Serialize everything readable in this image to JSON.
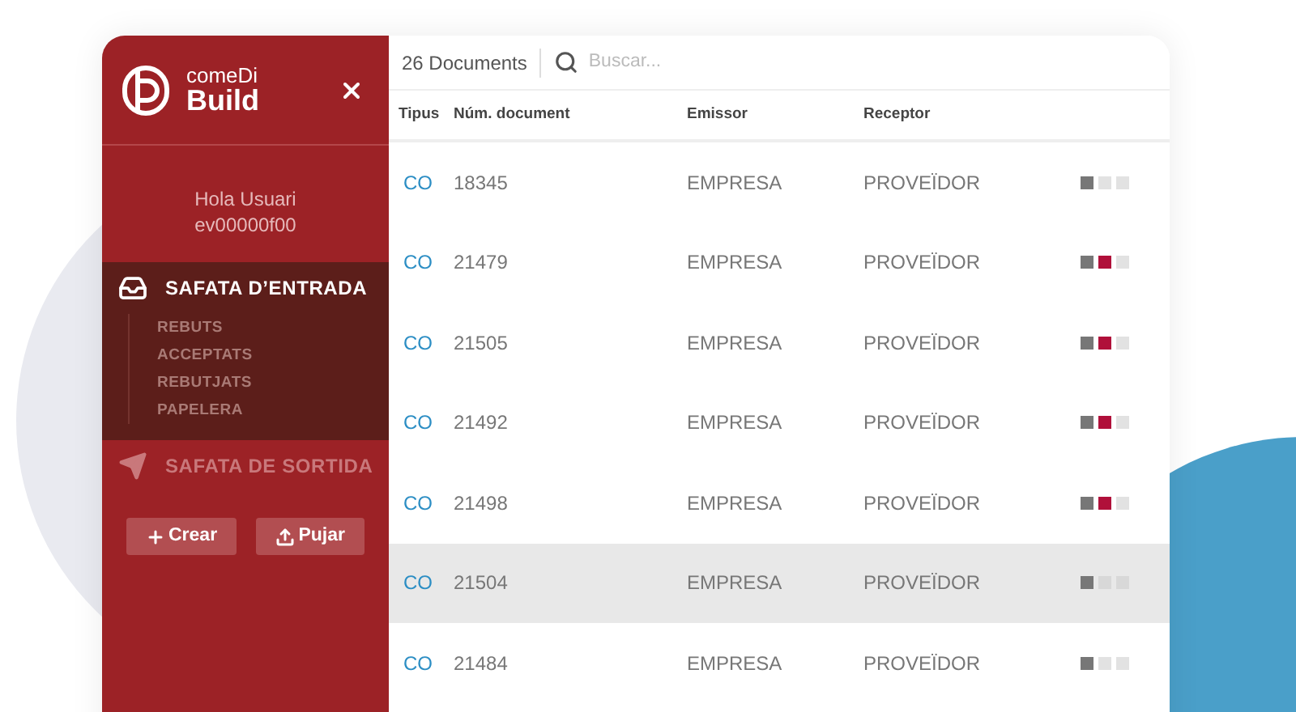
{
  "sidebar": {
    "logo": {
      "line1": "comeDi",
      "line2": "Build"
    },
    "greeting": "Hola Usuari",
    "user_id": "ev00000f00",
    "nav": [
      {
        "label": "SAFATA D’ENTRADA",
        "kind": "inbox",
        "selected": true,
        "children": [
          {
            "label": "REBUTS"
          },
          {
            "label": "ACCEPTATS"
          },
          {
            "label": "REBUTJATS"
          },
          {
            "label": "PAPELERA"
          }
        ]
      },
      {
        "label": "SAFATA DE SORTIDA",
        "kind": "outbox",
        "selected": false
      }
    ],
    "buttons": [
      {
        "label": "Crear",
        "kind": "create"
      },
      {
        "label": "Pujar",
        "kind": "upload"
      }
    ]
  },
  "toolbar": {
    "count": "26 Documents",
    "search": {
      "placeholder": "Buscar..."
    }
  },
  "table": {
    "columns": [
      "Tipus",
      "Núm. document",
      "Emissor",
      "Receptor"
    ],
    "rows": [
      {
        "type": "CO",
        "number": "18345",
        "issuer": "EMPRESA",
        "receiver": "PROVEÏDOR",
        "selected": false,
        "status": [
          {
            "color": "#777777"
          },
          {
            "color": "#e2e2e2"
          },
          {
            "color": "#e2e2e2"
          }
        ]
      },
      {
        "type": "CO",
        "number": "21479",
        "issuer": "EMPRESA",
        "receiver": "PROVEÏDOR",
        "selected": false,
        "status": [
          {
            "color": "#777777"
          },
          {
            "color": "#b0103a"
          },
          {
            "color": "#e2e2e2"
          }
        ]
      },
      {
        "type": "CO",
        "number": "21505",
        "issuer": "EMPRESA",
        "receiver": "PROVEÏDOR",
        "selected": false,
        "status": [
          {
            "color": "#777777"
          },
          {
            "color": "#b0103a"
          },
          {
            "color": "#e2e2e2"
          }
        ]
      },
      {
        "type": "CO",
        "number": "21492",
        "issuer": "EMPRESA",
        "receiver": "PROVEÏDOR",
        "selected": false,
        "status": [
          {
            "color": "#777777"
          },
          {
            "color": "#b0103a"
          },
          {
            "color": "#e2e2e2"
          }
        ]
      },
      {
        "type": "CO",
        "number": "21498",
        "issuer": "EMPRESA",
        "receiver": "PROVEÏDOR",
        "selected": false,
        "status": [
          {
            "color": "#777777"
          },
          {
            "color": "#b0103a"
          },
          {
            "color": "#e2e2e2"
          }
        ]
      },
      {
        "type": "CO",
        "number": "21504",
        "issuer": "EMPRESA",
        "receiver": "PROVEÏDOR",
        "selected": true,
        "status": [
          {
            "color": "#777777"
          },
          {
            "color": "#d8d8d8"
          },
          {
            "color": "#d8d8d8"
          }
        ]
      },
      {
        "type": "CO",
        "number": "21484",
        "issuer": "EMPRESA",
        "receiver": "PROVEÏDOR",
        "selected": false,
        "status": [
          {
            "color": "#777777"
          },
          {
            "color": "#e2e2e2"
          },
          {
            "color": "#e2e2e2"
          }
        ]
      }
    ]
  }
}
